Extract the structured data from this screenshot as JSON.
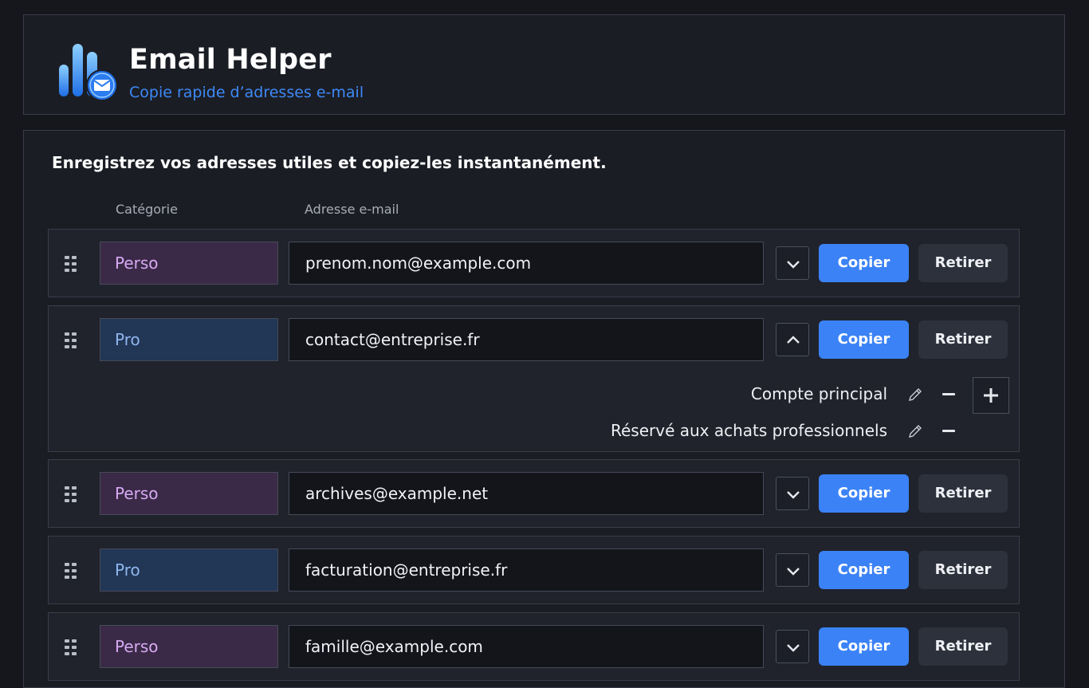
{
  "app": {
    "title": "Email Helper",
    "subtitle": "Copie rapide d’adresses e-mail"
  },
  "main": {
    "intro": "Enregistrez vos adresses utiles et copiez-les instantanément.",
    "columns": {
      "category": "Catégorie",
      "address": "Adresse e-mail"
    }
  },
  "rows": [
    {
      "category": "Perso",
      "address": "prenom.nom@example.com",
      "expanded": false,
      "copy_label": "Copier",
      "remove_label": "Retirer"
    },
    {
      "category": "Pro",
      "address": "contact@entreprise.fr",
      "expanded": true,
      "copy_label": "Copier",
      "remove_label": "Retirer",
      "notes": [
        "Compte principal",
        "Réservé aux achats professionnels"
      ]
    },
    {
      "category": "Perso",
      "address": "archives@example.net",
      "expanded": false,
      "copy_label": "Copier",
      "remove_label": "Retirer"
    },
    {
      "category": "Pro",
      "address": "facturation@entreprise.fr",
      "expanded": false,
      "copy_label": "Copier",
      "remove_label": "Retirer"
    },
    {
      "category": "Perso",
      "address": "famille@example.com",
      "expanded": false,
      "copy_label": "Copier",
      "remove_label": "Retirer"
    }
  ],
  "icons": {
    "logo": "bar-chart-email-logo",
    "drag": "drag-handle-icon",
    "expand": "chevron-down-icon",
    "collapse": "chevron-up-icon",
    "edit": "pencil-icon",
    "delete_note": "minus-icon",
    "add_note": "plus-icon"
  },
  "colors": {
    "accent": "#3b82f6",
    "perso_bg": "#3a2a47",
    "perso_text": "#d7a9f3",
    "pro_bg": "#223656",
    "pro_text": "#8fb7ee",
    "background": "#16171d",
    "panel": "#1b1d25"
  }
}
